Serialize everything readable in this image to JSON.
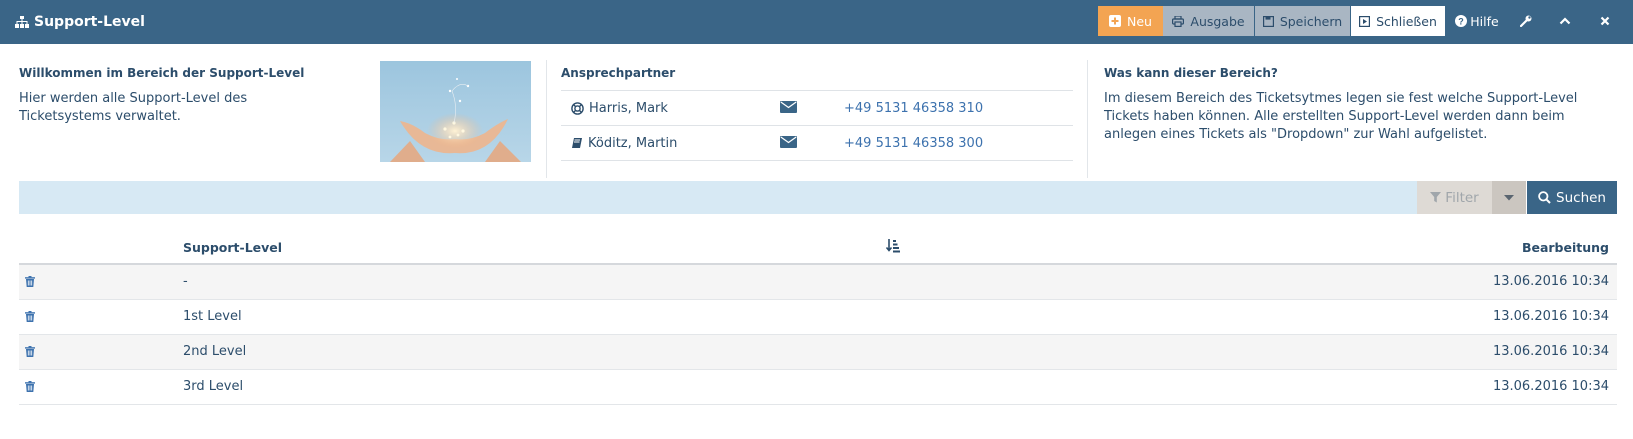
{
  "header": {
    "title": "Support-Level",
    "buttons": {
      "neu": "Neu",
      "ausgabe": "Ausgabe",
      "speichern": "Speichern",
      "schliessen": "Schließen",
      "hilfe": "Hilfe"
    },
    "icons": [
      "sitemap-icon",
      "plus-square-icon",
      "print-icon",
      "save-icon",
      "close-square-icon",
      "question-circle-icon",
      "wrench-icon",
      "chevron-up-icon",
      "close-icon"
    ]
  },
  "welcome": {
    "title": "Willkommen im Bereich der Support-Level",
    "text": "Hier werden alle Support-Level des Ticketsystems verwaltet."
  },
  "contacts": {
    "title": "Ansprechpartner",
    "items": [
      {
        "name": "Harris, Mark",
        "icon": "life-ring-icon",
        "phone": "+49 5131 46358 310"
      },
      {
        "name": "Köditz, Martin",
        "icon": "book-icon",
        "phone": "+49 5131 46358 300"
      }
    ]
  },
  "about": {
    "title": "Was kann dieser Bereich?",
    "text": "Im diesem Bereich des Ticketsytmes legen sie fest welche Support-Level Tickets haben können. Alle erstellten Support-Level werden dann beim anlegen eines Tickets als \"Dropdown\" zur Wahl aufgelistet."
  },
  "filter": {
    "filter_label": "Filter",
    "search_label": "Suchen"
  },
  "table": {
    "columns": {
      "level": "Support-Level",
      "edited": "Bearbeitung"
    },
    "rows": [
      {
        "level": "-",
        "edited": "13.06.2016 10:34"
      },
      {
        "level": "1st Level",
        "edited": "13.06.2016 10:34"
      },
      {
        "level": "2nd Level",
        "edited": "13.06.2016 10:34"
      },
      {
        "level": "3rd Level",
        "edited": "13.06.2016 10:34"
      }
    ]
  },
  "colors": {
    "header_bg": "#3a6587",
    "accent_orange": "#f3a452",
    "filterbar_bg": "#d7e9f4",
    "link_blue": "#3d72ae"
  }
}
